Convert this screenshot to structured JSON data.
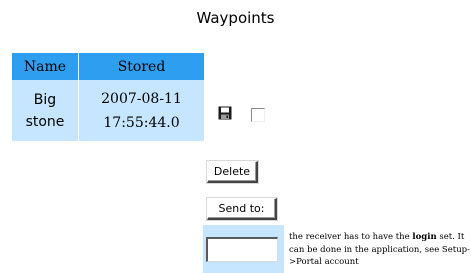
{
  "page": {
    "title": "Waypoints"
  },
  "table": {
    "headers": {
      "name": "Name",
      "stored": "Stored"
    },
    "rows": [
      {
        "name": "Big stone",
        "stored_date": "2007-08-11",
        "stored_time": "17:55:44.0"
      }
    ]
  },
  "actions": {
    "save_icon": "floppy-disk-icon",
    "delete_label": "Delete",
    "send_label": "Send to:",
    "recipient_value": ""
  },
  "note": {
    "part1": "the receiver has to have the ",
    "bold": "login",
    "part2": " set. It can be done in the application, see Setup->Portal account"
  },
  "colors": {
    "header_bg": "#2e9ef1",
    "row_bg": "#c6e6ff"
  }
}
